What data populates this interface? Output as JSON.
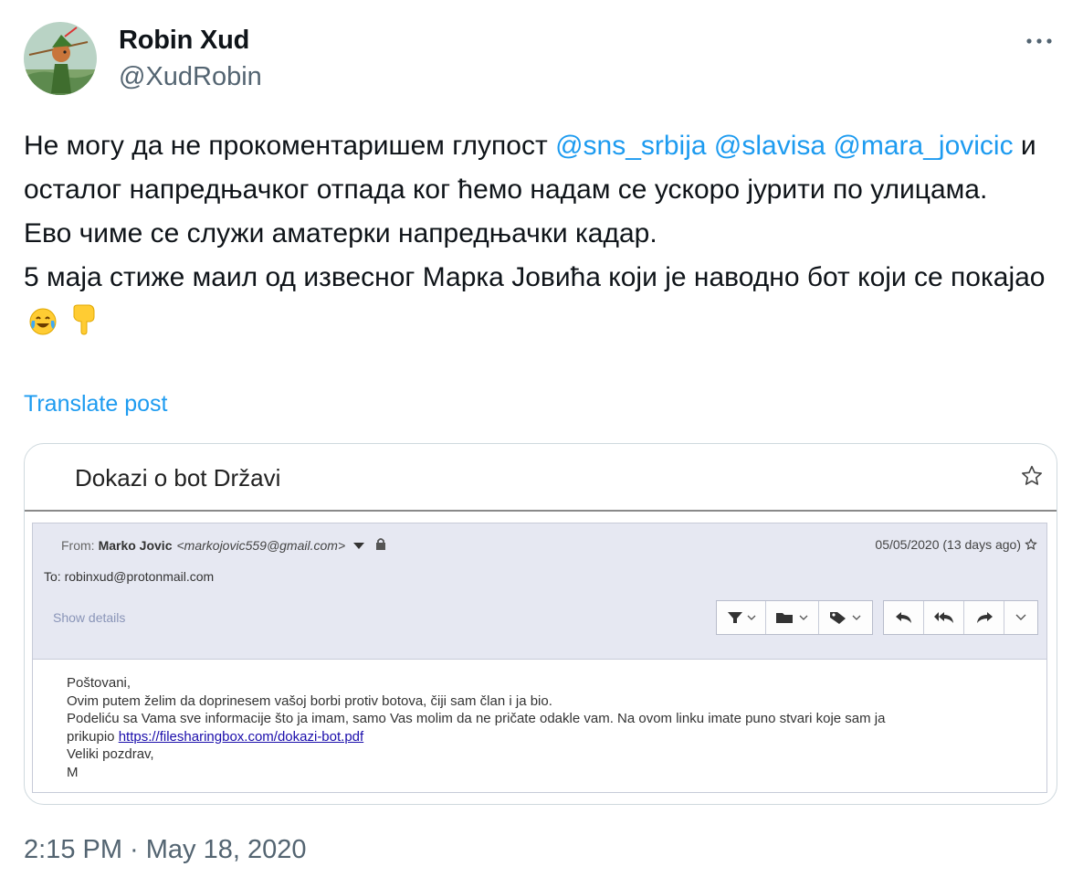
{
  "author": {
    "name": "Robin Xud",
    "handle": "@XudRobin",
    "avatar_icon": "cartoon-archer-avatar"
  },
  "tweet": {
    "seg1": "Не могу да не прокоментаришем глупост ",
    "mention1": "@sns_srbija",
    "mention2": "@slavisa",
    "mention3": "@mara_jovicic",
    "seg2": " и осталог напредњачког отпада ког ћемо надам се ускоро јурити по улицама.",
    "line2": "Ево чиме се служи аматерки напредњачки кадар.",
    "line3": "5 маја стиже маил од извесног Марка Јовића који је наводно бот који се покајао",
    "emojis": [
      "face-with-tears-of-joy",
      "backhand-index-pointing-down"
    ],
    "translate_label": "Translate post",
    "timestamp": "2:15 PM · May 18, 2020"
  },
  "email": {
    "subject": "Dokazi o bot Državi",
    "from_label": "From:",
    "sender_name": "Marko Jovic",
    "sender_email": "<markojovic559@gmail.com>",
    "date": "05/05/2020 (13 days ago)",
    "to_label": "To:",
    "to_address": "robinxud@protonmail.com",
    "show_details": "Show details",
    "body_lines": [
      "Poštovani,",
      "Ovim putem želim da doprinesem vašoj borbi protiv botova, čiji sam član i ja bio.",
      "Podeliću sa Vama sve informacije što ja imam, samo Vas molim da ne pričate odakle vam. Na ovom linku imate puno stvari koje sam ja",
      "prikupio ",
      "Veliki pozdrav,",
      "M"
    ],
    "link": "https://filesharingbox.com/dokazi-bot.pdf"
  },
  "colors": {
    "accent": "#1d9bf0",
    "secondary_text": "#536471",
    "mail_header_bg": "#e6e8f2"
  }
}
